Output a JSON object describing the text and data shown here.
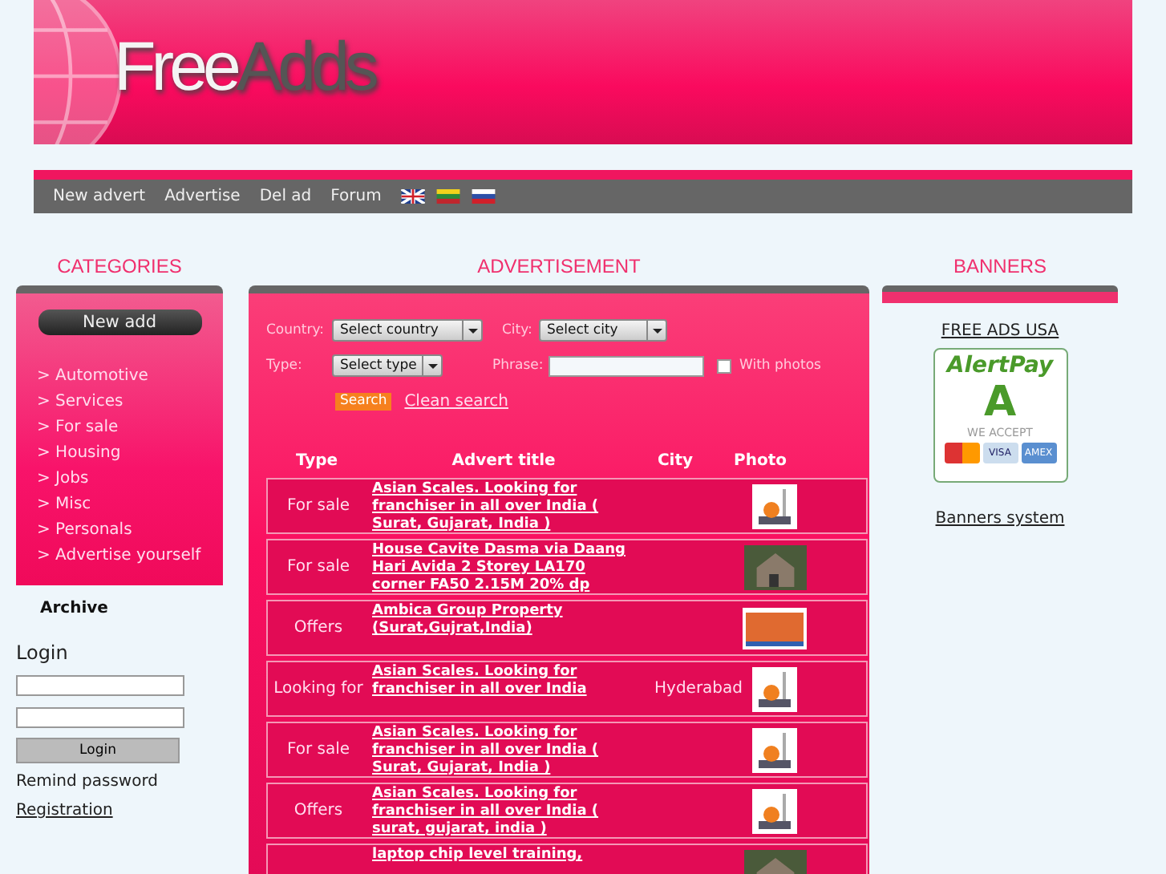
{
  "header": {
    "logo": {
      "first": "Free",
      "second": "Adds"
    }
  },
  "nav": {
    "links": [
      "New advert",
      "Advertise",
      "Del ad",
      "Forum"
    ],
    "flags": [
      {
        "kind": "uk"
      },
      {
        "kind": "lt"
      },
      {
        "kind": "ru"
      }
    ]
  },
  "categories": {
    "title": "CATEGORIES",
    "new_button": "New add",
    "items": [
      "> Automotive",
      "> Services",
      "> For sale",
      "> Housing",
      "> Jobs",
      "> Misc",
      "> Personals",
      "> Advertise yourself"
    ],
    "archive": "Archive"
  },
  "login": {
    "title": "Login",
    "button": "Login",
    "remind": "Remind password",
    "register": "Registration"
  },
  "advertisement": {
    "title": "ADVERTISEMENT",
    "search": {
      "country_label": "Country:",
      "country": "Select country",
      "city_label": "City:",
      "city": "Select city",
      "type_label": "Type:",
      "type": "Select type",
      "phrase_label": "Phrase:",
      "with_photos": "With photos",
      "with_photos_checked": false,
      "search_button": "Search",
      "clean": "Clean search"
    },
    "table": {
      "columns": [
        "Type",
        "Advert title",
        "City",
        "Photo"
      ],
      "rows": [
        {
          "type": "For sale",
          "title": "Asian Scales. Looking for franchiser in all over India ( Surat, Gujarat, India )",
          "city": "",
          "photo": {
            "kind": "scale"
          }
        },
        {
          "type": "For sale",
          "title": "House Cavite Dasma via Daang Hari Avida 2 Storey LA170 corner FA50 2.15M 20% dp",
          "city": "",
          "photo": {
            "kind": "house"
          }
        },
        {
          "type": "Offers",
          "title": "Ambica Group Property (Surat,Gujrat,India)",
          "city": "",
          "photo": {
            "kind": "banner"
          }
        },
        {
          "type": "Looking for",
          "title": "Asian Scales. Looking for franchiser in all over India",
          "city": "Hyderabad",
          "photo": {
            "kind": "scale"
          }
        },
        {
          "type": "For sale",
          "title": "Asian Scales. Looking for franchiser in all over India ( Surat, Gujarat, India )",
          "city": "",
          "photo": {
            "kind": "scale"
          }
        },
        {
          "type": "Offers",
          "title": "Asian Scales. Looking for franchiser in all over India ( surat, gujarat, india )",
          "city": "",
          "photo": {
            "kind": "scale"
          }
        },
        {
          "type": "",
          "title": "laptop chip level training,",
          "city": "",
          "photo": {
            "kind": "house"
          }
        }
      ]
    }
  },
  "banners": {
    "title": "BANNERS",
    "link": "FREE ADS USA",
    "ad": {
      "brand": "AlertPay",
      "mark": "A",
      "accept": "WE ACCEPT",
      "cards": [
        "VISA",
        "AMEX"
      ]
    },
    "system": "Banners system"
  }
}
